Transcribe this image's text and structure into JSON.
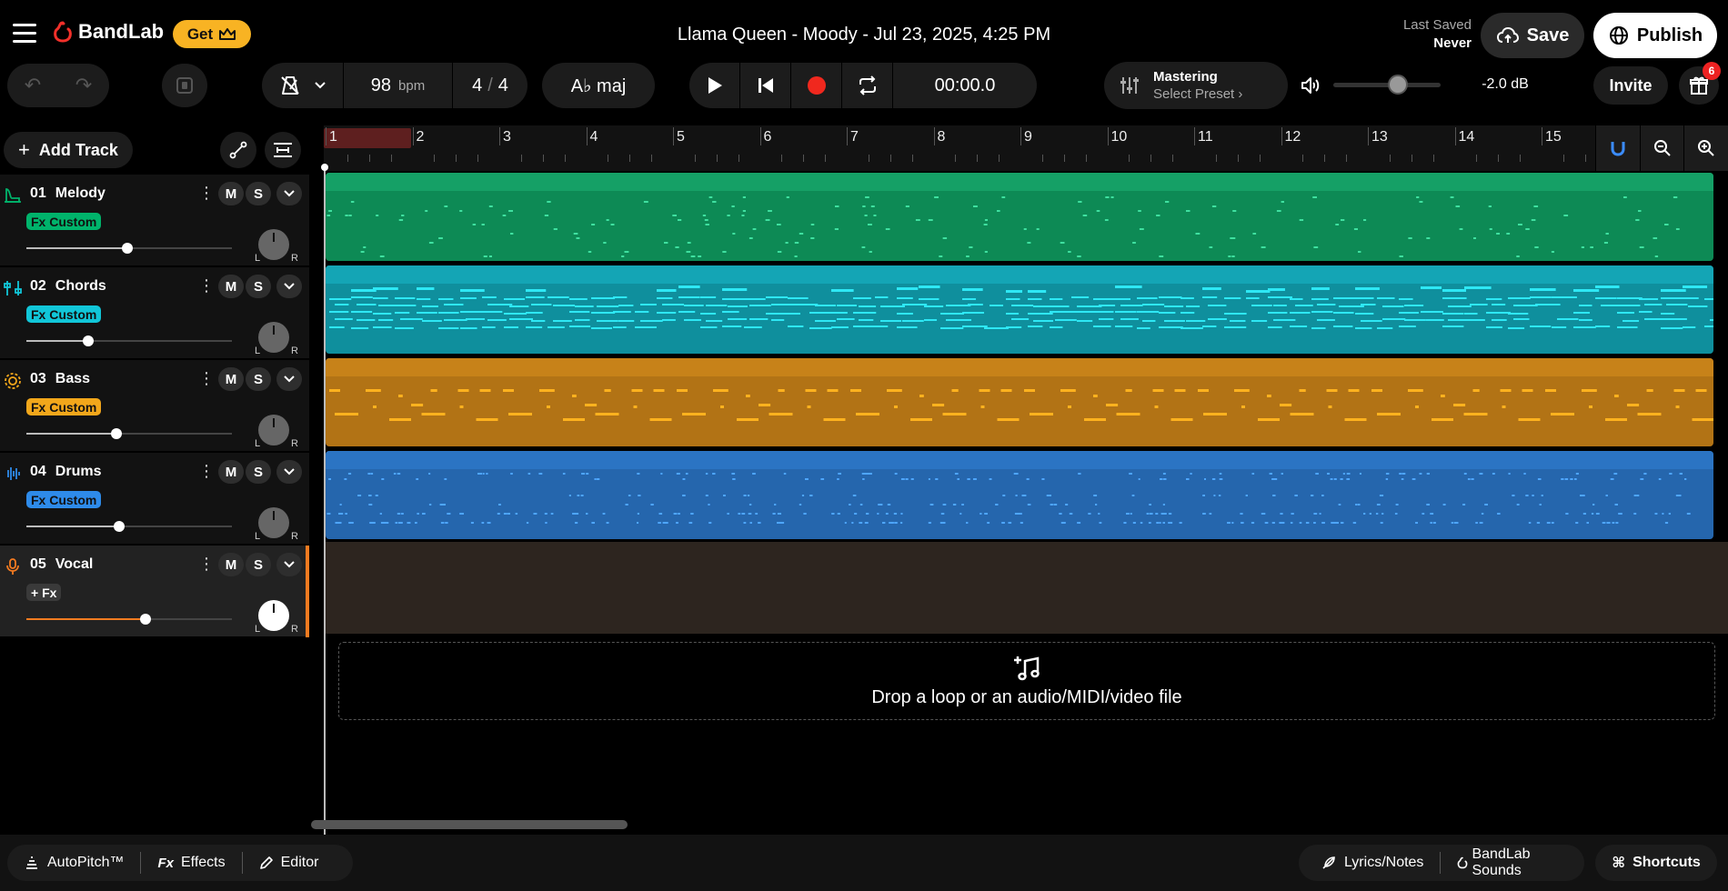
{
  "header": {
    "brand": "BandLab",
    "get_label": "Get",
    "project_title": "Llama Queen - Moody - Jul 23, 2025, 4:25 PM",
    "last_saved_label": "Last Saved",
    "last_saved_value": "Never",
    "save_label": "Save",
    "publish_label": "Publish"
  },
  "transport": {
    "bpm_value": "98",
    "bpm_unit": "bpm",
    "time_sig_top": "4",
    "time_sig_slash": "/",
    "time_sig_bottom": "4",
    "key": "A♭ maj",
    "time": "00:00.0",
    "mastering_title": "Mastering",
    "mastering_preset": "Select Preset",
    "master_db": "-2.0 dB",
    "master_volume": 0.6,
    "invite_label": "Invite",
    "notification_count": "6"
  },
  "tracks_panel": {
    "add_track_label": "Add Track",
    "mute_label": "M",
    "solo_label": "S",
    "pan_left": "L",
    "pan_right": "R"
  },
  "tracks": [
    {
      "number": "01",
      "name": "Melody",
      "fx": "Fx Custom",
      "color": "#00b36b",
      "region_color": "#0d8a55",
      "head_color": "#15a066",
      "note_color": "#3fe0a0",
      "volume": 0.49,
      "icon": "piano-icon"
    },
    {
      "number": "02",
      "name": "Chords",
      "fx": "Fx Custom",
      "color": "#11c6d8",
      "region_color": "#0f8f9d",
      "head_color": "#14a5b5",
      "note_color": "#2ee8f5",
      "volume": 0.3,
      "icon": "keyboard-icon"
    },
    {
      "number": "03",
      "name": "Bass",
      "fx": "Fx Custom",
      "color": "#f2a71b",
      "region_color": "#b27315",
      "head_color": "#c78219",
      "note_color": "#ffb21e",
      "volume": 0.44,
      "icon": "bass-icon"
    },
    {
      "number": "04",
      "name": "Drums",
      "fx": "Fx Custom",
      "color": "#2e8bea",
      "region_color": "#2566ad",
      "head_color": "#2b74c3",
      "note_color": "#4ea6ff",
      "volume": 0.45,
      "icon": "drums-icon"
    },
    {
      "number": "05",
      "name": "Vocal",
      "fx": "+ Fx",
      "color": "#f57b20",
      "volume": 0.58,
      "icon": "microphone-icon"
    }
  ],
  "ruler": {
    "bars": [
      "1",
      "2",
      "3",
      "4",
      "5",
      "6",
      "7",
      "8",
      "9",
      "10",
      "11",
      "12",
      "13",
      "14",
      "15"
    ]
  },
  "drop_zone": {
    "text": "Drop a loop or an audio/MIDI/video file"
  },
  "bottom": {
    "autopitch": "AutoPitch™",
    "effects_fx": "Fx",
    "effects": "Effects",
    "editor": "Editor",
    "lyrics": "Lyrics/Notes",
    "sounds": "BandLab Sounds",
    "shortcuts": "Shortcuts"
  }
}
